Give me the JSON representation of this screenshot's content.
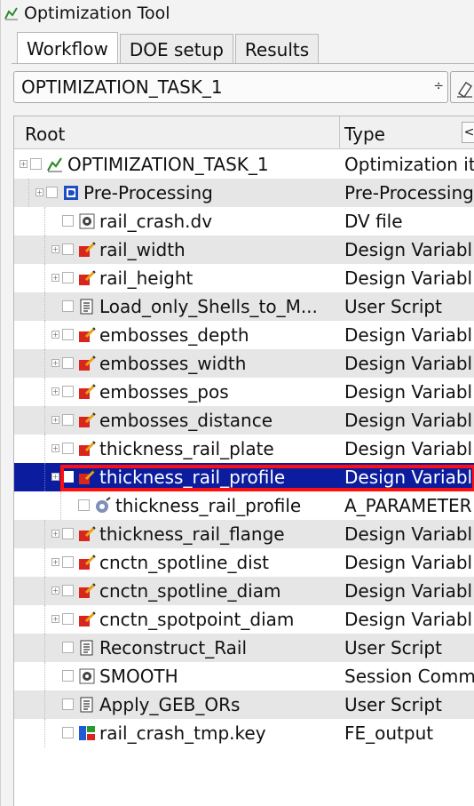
{
  "window": {
    "title": "Optimization Tool",
    "icon": "optimization-tool-icon"
  },
  "tabs": [
    {
      "label": "Workflow",
      "active": true
    },
    {
      "label": "DOE setup",
      "active": false
    },
    {
      "label": "Results",
      "active": false
    }
  ],
  "task_select": {
    "value": "OPTIMIZATION_TASK_1",
    "stepper": "÷"
  },
  "tree": {
    "headers": {
      "root": "Root",
      "type": "Type",
      "scroll": "<"
    },
    "rows": [
      {
        "name": "OPTIMIZATION_TASK_1",
        "type": "Optimization it",
        "icon": "task-icon",
        "level": 0
      },
      {
        "name": "Pre-Processing",
        "type": "Pre-Processing",
        "icon": "preprocessing-icon",
        "level": 1
      },
      {
        "name": "rail_crash.dv",
        "type": "DV file",
        "icon": "dv-file-icon",
        "level": 2
      },
      {
        "name": "rail_width",
        "type": "Design Variabl",
        "icon": "design-variable-icon",
        "level": 2
      },
      {
        "name": "rail_height",
        "type": "Design Variabl",
        "icon": "design-variable-icon",
        "level": 2
      },
      {
        "name": "Load_only_Shells_to_M...",
        "type": "User Script",
        "icon": "user-script-icon",
        "level": 2
      },
      {
        "name": "embosses_depth",
        "type": "Design Variabl",
        "icon": "design-variable-icon",
        "level": 2
      },
      {
        "name": "embosses_width",
        "type": "Design Variabl",
        "icon": "design-variable-icon",
        "level": 2
      },
      {
        "name": "embosses_pos",
        "type": "Design Variabl",
        "icon": "design-variable-icon",
        "level": 2
      },
      {
        "name": "embosses_distance",
        "type": "Design Variabl",
        "icon": "design-variable-icon",
        "level": 2
      },
      {
        "name": "thickness_rail_plate",
        "type": "Design Variabl",
        "icon": "design-variable-icon",
        "level": 2
      },
      {
        "name": "thickness_rail_profile",
        "type": "Design Variabl",
        "icon": "design-variable-icon",
        "level": 2,
        "selected": true
      },
      {
        "name": "thickness_rail_profile",
        "type": "A_PARAMETER",
        "icon": "parameter-icon",
        "level": 3
      },
      {
        "name": "thickness_rail_flange",
        "type": "Design Variabl",
        "icon": "design-variable-icon",
        "level": 2
      },
      {
        "name": "cnctn_spotline_dist",
        "type": "Design Variabl",
        "icon": "design-variable-icon",
        "level": 2
      },
      {
        "name": "cnctn_spotline_diam",
        "type": "Design Variabl",
        "icon": "design-variable-icon",
        "level": 2
      },
      {
        "name": "cnctn_spotpoint_diam",
        "type": "Design Variabl",
        "icon": "design-variable-icon",
        "level": 2
      },
      {
        "name": "Reconstruct_Rail",
        "type": "User Script",
        "icon": "user-script-icon",
        "level": 2
      },
      {
        "name": "SMOOTH",
        "type": "Session Comm",
        "icon": "session-command-icon",
        "level": 2
      },
      {
        "name": "Apply_GEB_ORs",
        "type": "User Script",
        "icon": "user-script-icon",
        "level": 2
      },
      {
        "name": "rail_crash_tmp.key",
        "type": "FE_output",
        "icon": "fe-output-icon",
        "level": 2
      }
    ]
  },
  "colors": {
    "selection": "#0b1c9e",
    "highlight": "#ff1010",
    "alt_row": "#e6e6e6"
  }
}
